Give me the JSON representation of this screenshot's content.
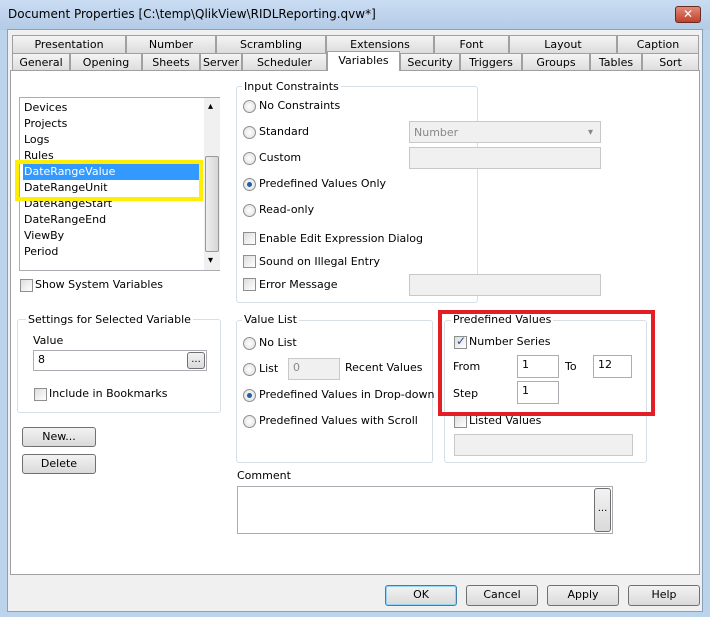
{
  "window": {
    "title": "Document Properties [C:\\temp\\QlikView\\RIDLReporting.qvw*]",
    "close": "✕"
  },
  "tabs_row1": [
    "Presentation",
    "Number",
    "Scrambling",
    "Extensions",
    "Font",
    "Layout",
    "Caption"
  ],
  "tabs_row2": [
    "General",
    "Opening",
    "Sheets",
    "Server",
    "Scheduler",
    "Variables",
    "Security",
    "Triggers",
    "Groups",
    "Tables",
    "Sort"
  ],
  "active_tab": "Variables",
  "variables": {
    "items": [
      "Devices",
      "Projects",
      "Logs",
      "Rules",
      "DateRangeValue",
      "DateRangeUnit",
      "DateRangeStart",
      "DateRangeEnd",
      "ViewBy",
      "Period"
    ],
    "selected": "DateRangeValue",
    "show_system": "Show System Variables"
  },
  "settings": {
    "legend": "Settings for Selected Variable",
    "value_label": "Value",
    "value": "8",
    "browse": "...",
    "include_bookmarks": "Include in Bookmarks"
  },
  "buttons": {
    "new": "New...",
    "delete": "Delete",
    "ok": "OK",
    "cancel": "Cancel",
    "apply": "Apply",
    "help": "Help"
  },
  "input_constraints": {
    "legend": "Input Constraints",
    "no_constraints": "No Constraints",
    "standard": "Standard",
    "standard_value": "Number",
    "custom": "Custom",
    "predefined_only": "Predefined Values Only",
    "read_only": "Read-only",
    "enable_edit": "Enable Edit Expression Dialog",
    "sound": "Sound on Illegal Entry",
    "error_message": "Error Message",
    "selected": "Predefined Values Only"
  },
  "value_list": {
    "legend": "Value List",
    "no_list": "No List",
    "list": "List",
    "recent_count": "0",
    "recent_values": "Recent Values",
    "dropdown": "Predefined Values in Drop-down",
    "scroll": "Predefined Values with Scroll",
    "selected": "Predefined Values in Drop-down"
  },
  "predefined": {
    "legend": "Predefined Values",
    "number_series": "Number Series",
    "number_series_checked": true,
    "from_label": "From",
    "from": "1",
    "to_label": "To",
    "to": "12",
    "step_label": "Step",
    "step": "1",
    "listed_values": "Listed Values",
    "listed_checked": false
  },
  "comment": {
    "label": "Comment",
    "value": "",
    "browse": "..."
  },
  "highlights": {
    "yellow": "#ffee00",
    "red": "#e31e24",
    "selection": "#3399ff"
  }
}
